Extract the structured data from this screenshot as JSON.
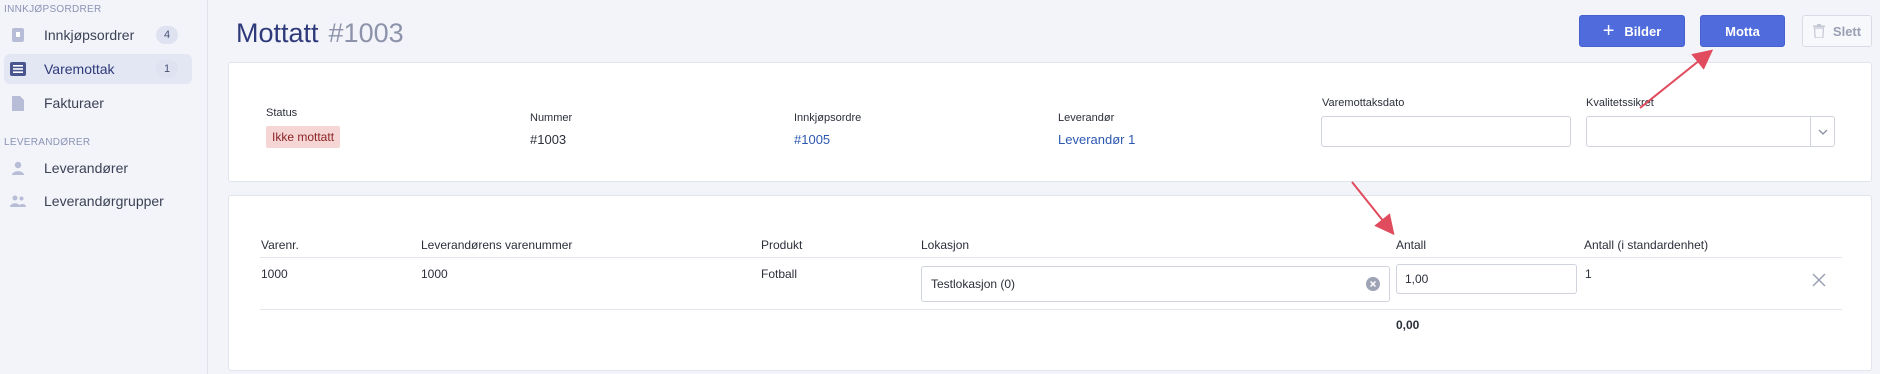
{
  "sidebar": {
    "section_purchase": "INNKJØPSORDRER",
    "section_suppliers": "LEVERANDØRER",
    "items": [
      {
        "label": "Innkjøpsordrer",
        "count": "4",
        "icon": "purchase-order-icon"
      },
      {
        "label": "Varemottak",
        "count": "1",
        "icon": "receipt-icon",
        "active": true
      },
      {
        "label": "Fakturaer",
        "icon": "invoice-icon"
      },
      {
        "label": "Leverandører",
        "icon": "user-icon"
      },
      {
        "label": "Leverandørgrupper",
        "icon": "user-group-icon"
      }
    ]
  },
  "header": {
    "title": "Mottatt",
    "number": "#1003",
    "buttons": {
      "images": "Bilder",
      "receive": "Motta",
      "delete": "Slett"
    }
  },
  "details": {
    "status_label": "Status",
    "status_value": "Ikke mottatt",
    "number_label": "Nummer",
    "number_value": "#1003",
    "po_label": "Innkjøpsordre",
    "po_value": "#1005",
    "supplier_label": "Leverandør",
    "supplier_value": "Leverandør 1",
    "receipt_date_label": "Varemottaksdato",
    "receipt_date_value": "",
    "quality_label": "Kvalitetssikret",
    "quality_value": ""
  },
  "table": {
    "columns": [
      "Varenr.",
      "Leverandørens varenummer",
      "Produkt",
      "Lokasjon",
      "Antall",
      "Antall (i standardenhet)"
    ],
    "rows": [
      {
        "item_no": "1000",
        "supplier_item_no": "1000",
        "product": "Fotball",
        "location": "Testlokasjon (0)",
        "quantity": "1,00",
        "quantity_std": "1"
      }
    ],
    "total": "0,00"
  },
  "colors": {
    "primary": "#4f6bdc",
    "title": "#2e3a7a",
    "status_bg": "#f6d5d5",
    "arrow": "#e04b5e"
  }
}
